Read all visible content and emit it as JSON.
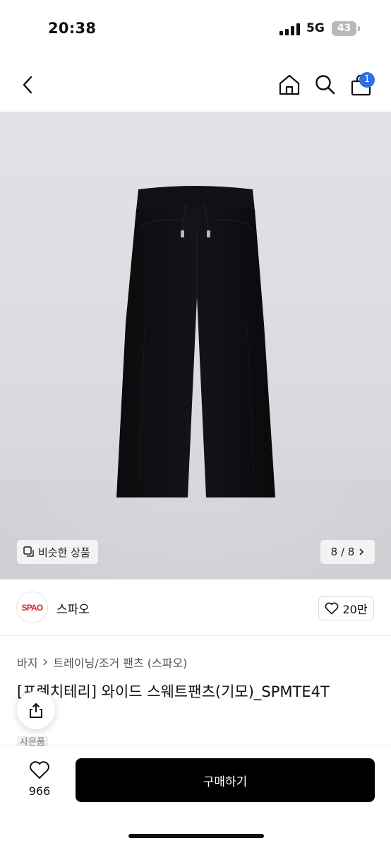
{
  "status_bar": {
    "time": "20:38",
    "network": "5G",
    "battery": "43"
  },
  "nav": {
    "back_icon": "chevron-left-icon",
    "home_icon": "home-icon",
    "search_icon": "search-icon",
    "cart_icon": "shopping-bag-icon",
    "cart_badge": "1",
    "badge_color": "#2f6ee8"
  },
  "gallery": {
    "similar_label": "비슷한 상품",
    "counter": "8 / 8",
    "product_color": "#0e0e11"
  },
  "brand": {
    "logo_text": "SPAO",
    "name": "스파오",
    "likes": "20만",
    "logo_color": "#d7262c"
  },
  "breadcrumb": [
    "바지",
    "트레이닝/조거 팬츠 (스파오)"
  ],
  "product": {
    "title": "[프렌치테리] 와이드 스웨트팬츠(기모)_SPMTE4T",
    "tag": "사은품"
  },
  "bottom": {
    "wish_count": "966",
    "buy_label": "구매하기",
    "buy_color": "#000000"
  }
}
